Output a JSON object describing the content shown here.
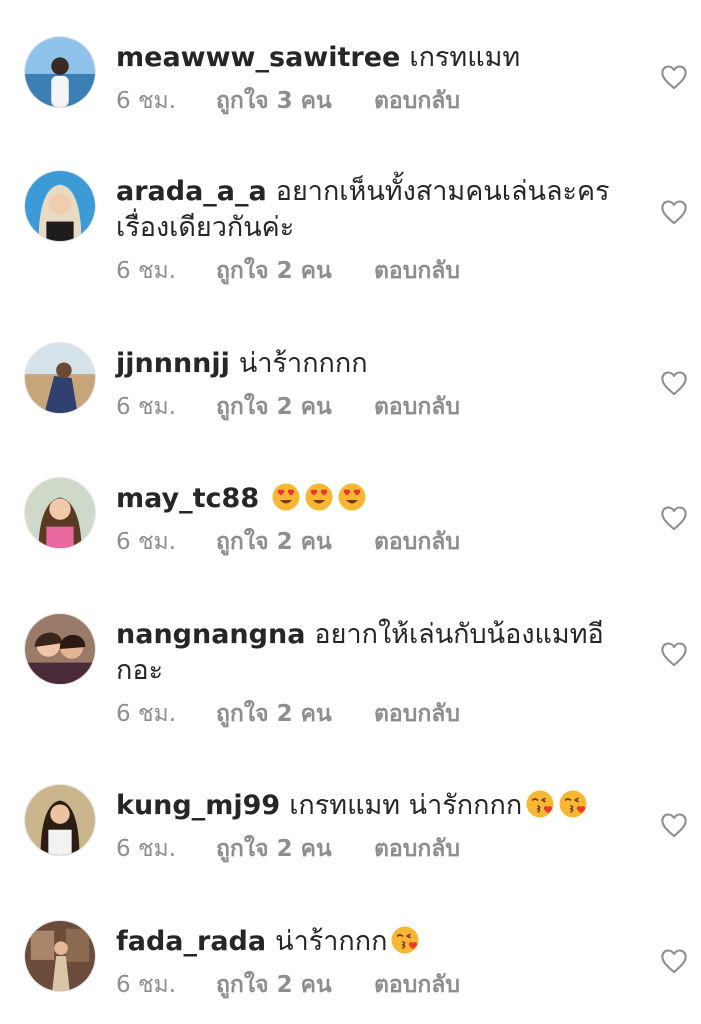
{
  "comments": [
    {
      "username": "meawww_sawitree",
      "text": "เกรทแมท",
      "time": "6 ชม.",
      "likes": "ถูกใจ 3 คน",
      "reply": "ตอบกลับ",
      "emojis": []
    },
    {
      "username": "arada_a_a",
      "text": "อยากเห็นทั้งสามคนเล่นละครเรื่องเดียวกันค่ะ",
      "time": "6 ชม.",
      "likes": "ถูกใจ 2 คน",
      "reply": "ตอบกลับ",
      "emojis": []
    },
    {
      "username": "jjnnnnjj",
      "text": "น่าร้ากกกก",
      "time": "6 ชม.",
      "likes": "ถูกใจ 2 คน",
      "reply": "ตอบกลับ",
      "emojis": []
    },
    {
      "username": "may_tc88",
      "text": "",
      "time": "6 ชม.",
      "likes": "ถูกใจ 2 คน",
      "reply": "ตอบกลับ",
      "emojis": [
        "heart-eyes",
        "heart-eyes",
        "heart-eyes"
      ]
    },
    {
      "username": "nangnangna",
      "text": "อยากให้เล่นกับน้องแมทอีกอะ",
      "time": "6 ชม.",
      "likes": "ถูกใจ 2 คน",
      "reply": "ตอบกลับ",
      "emojis": []
    },
    {
      "username": "kung_mj99",
      "text": "เกรทแมท น่ารักกกก",
      "time": "6 ชม.",
      "likes": "ถูกใจ 2 คน",
      "reply": "ตอบกลับ",
      "emojis": [
        "kissing-heart",
        "kissing-heart"
      ]
    },
    {
      "username": "fada_rada",
      "text": "น่าร้ากกก",
      "time": "6 ชม.",
      "likes": "ถูกใจ 2 คน",
      "reply": "ตอบกลับ",
      "emojis": [
        "kissing-heart"
      ]
    }
  ],
  "colors": {
    "text": "#262626",
    "meta": "#8e8e8e",
    "heart_outline": "#8e8e8e",
    "emoji_face": "#F7B733",
    "emoji_heart": "#E8352F"
  },
  "icons": {
    "like": "heart-outline-icon"
  }
}
